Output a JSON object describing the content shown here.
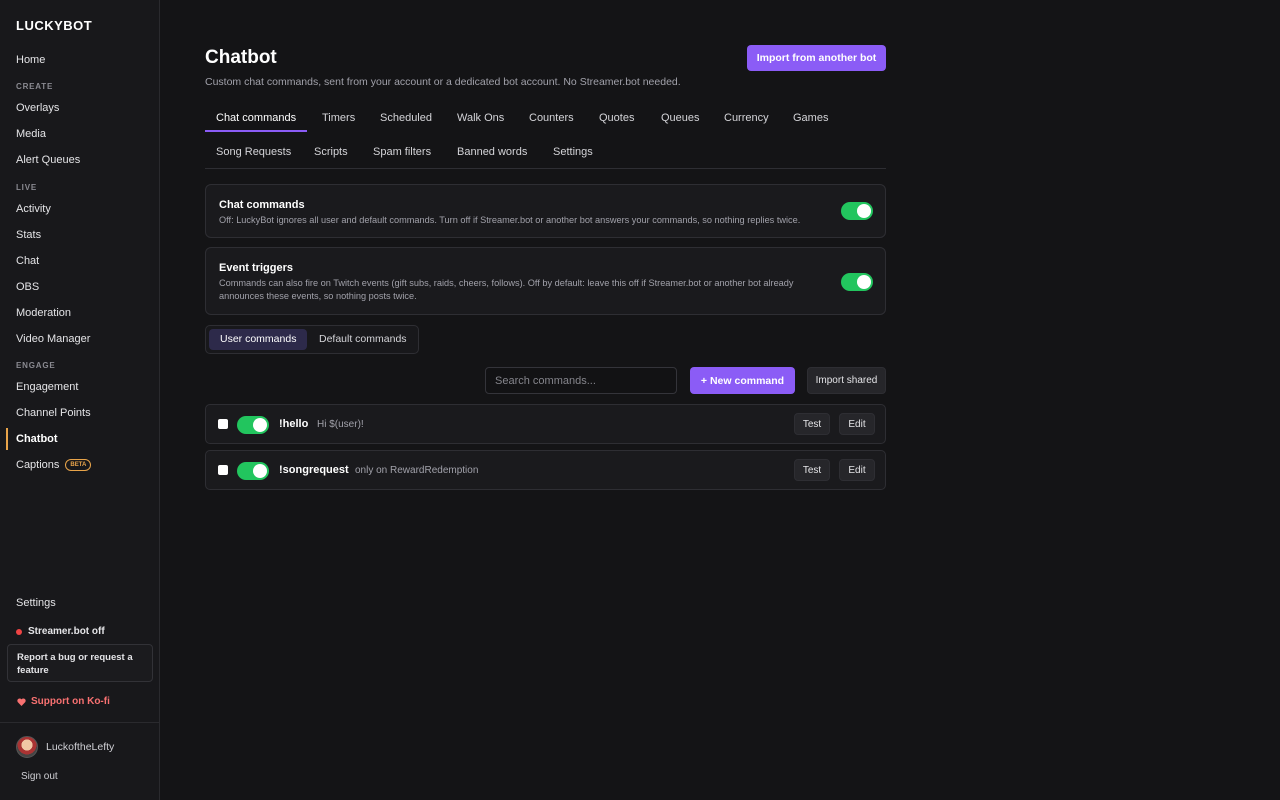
{
  "sidebar": {
    "brand": "LUCKYBOT",
    "home": "Home",
    "sections": {
      "create": "CREATE",
      "live": "LIVE",
      "engage": "ENGAGE"
    },
    "create_items": [
      "Overlays",
      "Media",
      "Alert Queues"
    ],
    "live_items": [
      "Activity",
      "Stats",
      "Chat",
      "OBS",
      "Moderation",
      "Video Manager"
    ],
    "engage_items": [
      "Engagement",
      "Channel Points",
      "Chatbot",
      "Captions"
    ],
    "beta_badge": "BETA",
    "settings": "Settings",
    "streamerbot_status": "Streamer.bot off",
    "report": "Report a bug or request a feature",
    "kofi": "Support on Ko-fi",
    "username": "LuckoftheLefty",
    "signout": "Sign out",
    "active_item": "Chatbot"
  },
  "header": {
    "title": "Chatbot",
    "subtitle": "Custom chat commands, sent from your account or a dedicated bot account. No Streamer.bot needed.",
    "import_button": "Import from another bot"
  },
  "tabs": {
    "row1": [
      "Chat commands",
      "Timers",
      "Scheduled",
      "Walk Ons",
      "Counters",
      "Quotes",
      "Queues",
      "Currency",
      "Games"
    ],
    "row2": [
      "Song Requests",
      "Scripts",
      "Spam filters",
      "Banned words",
      "Settings"
    ],
    "active": "Chat commands"
  },
  "cards": {
    "chat_commands": {
      "title": "Chat commands",
      "desc": "Off: LuckyBot ignores all user and default commands. Turn off if Streamer.bot or another bot answers your commands, so nothing replies twice.",
      "enabled": true
    },
    "event_triggers": {
      "title": "Event triggers",
      "desc": "Commands can also fire on Twitch events (gift subs, raids, cheers, follows). Off by default: leave this off if Streamer.bot or another bot already announces these events, so nothing posts twice.",
      "enabled": true
    }
  },
  "segments": {
    "user": "User commands",
    "default": "Default commands",
    "active": "User commands"
  },
  "toolbar": {
    "search_placeholder": "Search commands...",
    "new_command": "+ New command",
    "import_shared": "Import shared"
  },
  "commands": [
    {
      "name": "!hello",
      "response": "Hi $(user)!",
      "enabled": true,
      "test": "Test",
      "edit": "Edit"
    },
    {
      "name": "!songrequest",
      "response": "only on RewardRedemption",
      "enabled": true,
      "test": "Test",
      "edit": "Edit"
    }
  ],
  "colors": {
    "accent": "#8b5cf6",
    "toggle_on": "#22c55e",
    "active_marker": "#e8a44a",
    "status_off": "#ef4444"
  }
}
